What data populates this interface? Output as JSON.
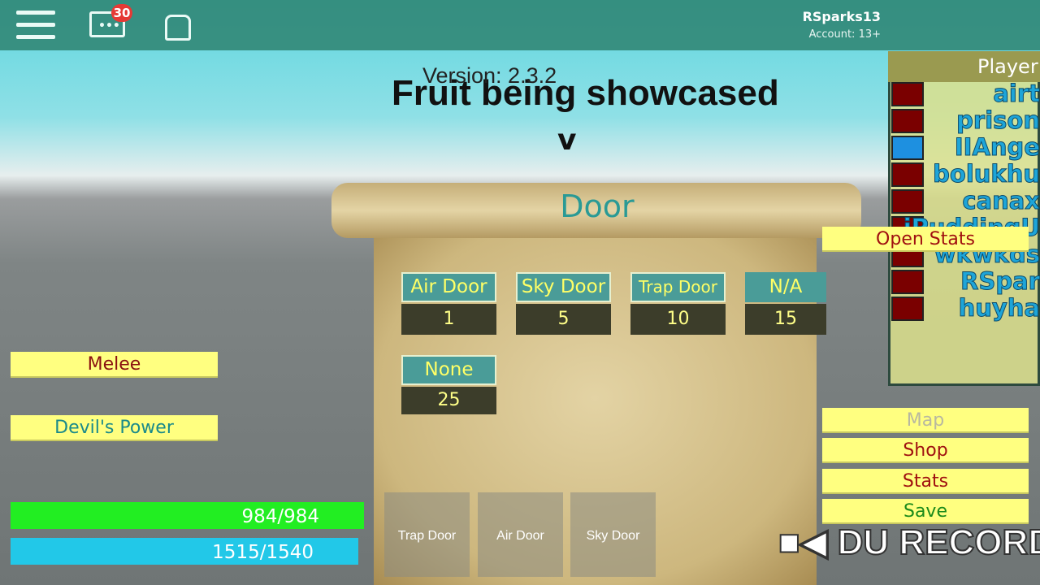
{
  "topbar": {
    "menu_icon": "hamburger-icon",
    "chat_icon": "chat-icon",
    "chat_badge": "30",
    "backpack_icon": "backpack-icon",
    "username": "RSparks13",
    "account": "Account: 13+"
  },
  "overlay": {
    "version": "Version: 2.3.2",
    "showcase": "Fruit being showcased",
    "arrow": "v"
  },
  "door_panel": {
    "title": "Door",
    "options": [
      {
        "name": "Air Door",
        "value": "1"
      },
      {
        "name": "Sky Door",
        "value": "5"
      },
      {
        "name": "Trap Door",
        "value": "10"
      },
      {
        "name": "N/A",
        "value": "15"
      },
      {
        "name": "None",
        "value": "25"
      }
    ],
    "tabs": [
      "Trap Door",
      "Air Door",
      "Sky Door"
    ]
  },
  "left": {
    "melee": "Melee",
    "devils_power": "Devil's Power",
    "health": "984/984",
    "health_fraction": 1.0,
    "energy": "1515/1540",
    "energy_fraction": 0.984
  },
  "right": {
    "open_stats": "Open Stats",
    "menu": [
      "Map",
      "Shop",
      "Stats",
      "Save"
    ]
  },
  "players": {
    "header": "Player",
    "list": [
      "airt",
      "prison",
      "IIAnge",
      "bolukhu",
      "canax",
      "iPuddingU",
      "wkwkds",
      "RSpar",
      "huyha"
    ]
  },
  "watermark": "DU RECORD",
  "colors": {
    "yellow_button": "#ffff80",
    "teal_header": "#4a9c98",
    "health": "#22ee22",
    "energy": "#22c8e8"
  }
}
